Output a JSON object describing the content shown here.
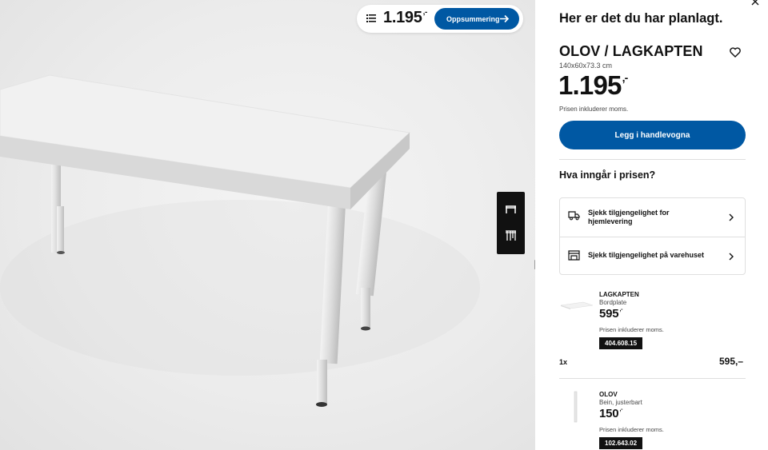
{
  "summary_bar": {
    "price": "1.195",
    "price_suffix": ",-",
    "button_label": "Oppsummering"
  },
  "panel": {
    "heading": "Her er det du har planlagt.",
    "product_title": "OLOV / LAGKAPTEN",
    "dimensions": "140x60x73.3 cm",
    "price": "1.195",
    "price_suffix": ",-",
    "vat_note": "Prisen inkluderer moms.",
    "add_to_cart_label": "Legg i handlevogna",
    "included_title": "Hva inngår i prisen?",
    "availability": [
      {
        "label": "Sjekk tilgjengelighet for hjemlevering",
        "icon": "truck-icon"
      },
      {
        "label": "Sjekk tilgjengelighet på varehuset",
        "icon": "store-icon"
      }
    ],
    "items": [
      {
        "name": "LAGKAPTEN",
        "description": "Bordplate",
        "price": "595",
        "price_suffix": ",-",
        "vat_note": "Prisen inkluderer moms.",
        "article_number": "404.608.15",
        "quantity": "1x",
        "total": "595,–"
      },
      {
        "name": "OLOV",
        "description": "Bein, justerbart",
        "price": "150",
        "price_suffix": ",-",
        "vat_note": "Prisen inkluderer moms.",
        "article_number": "102.643.02"
      }
    ]
  },
  "colors": {
    "ikea_blue": "#0058a3",
    "dark": "#111111",
    "border": "#dfdfdf",
    "scene_bg": "#ececec"
  }
}
